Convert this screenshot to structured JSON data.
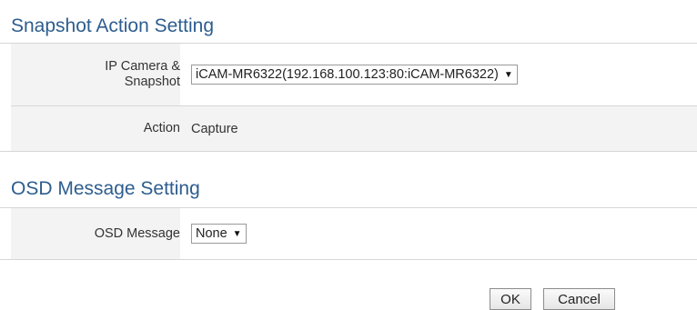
{
  "snapshot_section": {
    "title": "Snapshot Action Setting",
    "camera_label_line1": "IP Camera &",
    "camera_label_line2": "Snapshot",
    "camera_value": "iCAM-MR6322(192.168.100.123:80:iCAM-MR6322)",
    "action_label": "Action",
    "action_value": "Capture"
  },
  "osd_section": {
    "title": "OSD Message Setting",
    "message_label": "OSD Message",
    "message_value": "None"
  },
  "buttons": {
    "ok_label": "OK",
    "cancel_label": "Cancel"
  },
  "icons": {
    "dropdown": "dropdown-arrow-icon"
  },
  "colors": {
    "section_title": "#2d5d8e",
    "row_background": "#f3f3f3",
    "divider": "#d6d6d6"
  }
}
